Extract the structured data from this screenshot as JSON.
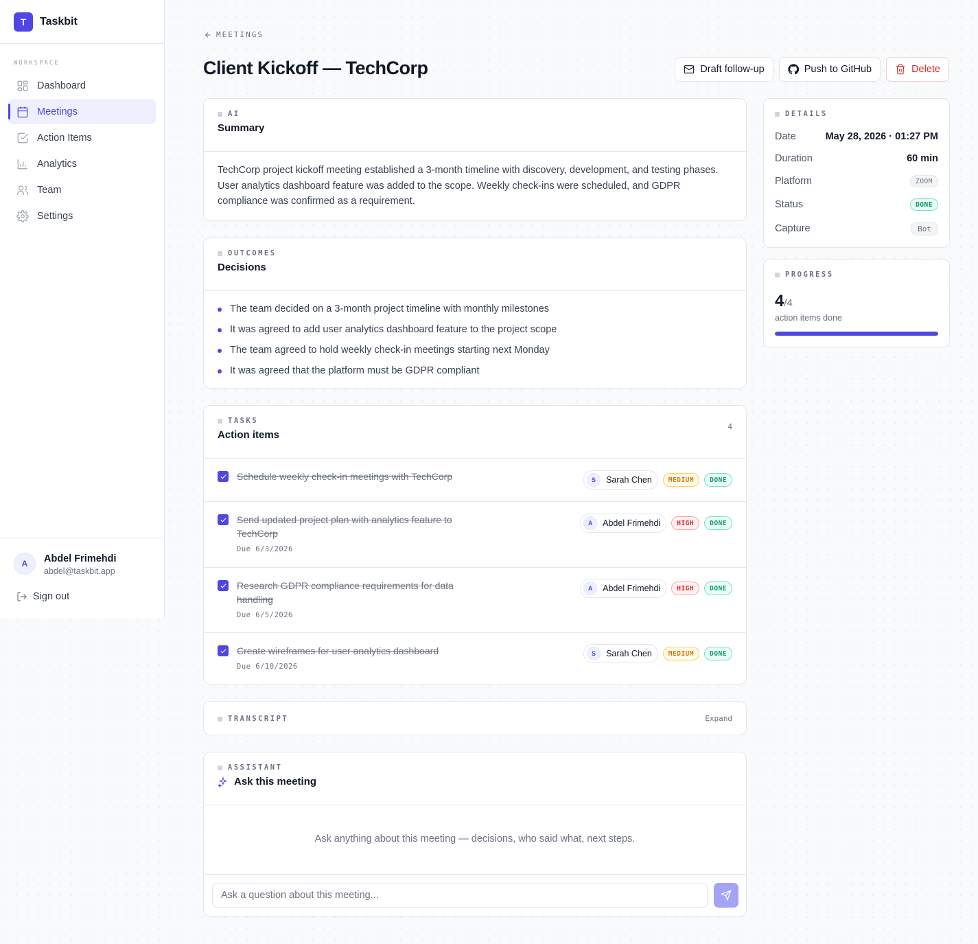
{
  "app": {
    "name": "Taskbit",
    "logo_letter": "T"
  },
  "sidebar": {
    "section_label": "WORKSPACE",
    "items": [
      {
        "label": "Dashboard",
        "icon": "dashboard-icon"
      },
      {
        "label": "Meetings",
        "icon": "calendar-icon",
        "active": true
      },
      {
        "label": "Action Items",
        "icon": "checkbox-icon"
      },
      {
        "label": "Analytics",
        "icon": "bar-chart-icon"
      },
      {
        "label": "Team",
        "icon": "users-icon"
      },
      {
        "label": "Settings",
        "icon": "gear-icon"
      }
    ],
    "user": {
      "initial": "A",
      "name": "Abdel Frimehdi",
      "email": "abdel@taskbit.app"
    },
    "sign_out": "Sign out"
  },
  "header": {
    "breadcrumb": "MEETINGS",
    "title": "Client Kickoff — TechCorp",
    "actions": {
      "draft": "Draft follow-up",
      "github": "Push to GitHub",
      "delete": "Delete"
    }
  },
  "summary": {
    "eyebrow": "AI",
    "title": "Summary",
    "text": "TechCorp project kickoff meeting established a 3-month timeline with discovery, development, and testing phases. User analytics dashboard feature was added to the scope. Weekly check-ins were scheduled, and GDPR compliance was confirmed as a requirement."
  },
  "decisions": {
    "eyebrow": "OUTCOMES",
    "title": "Decisions",
    "items": [
      "The team decided on a 3-month project timeline with monthly milestones",
      "It was agreed to add user analytics dashboard feature to the project scope",
      "The team agreed to hold weekly check-in meetings starting next Monday",
      "It was agreed that the platform must be GDPR compliant"
    ]
  },
  "tasks": {
    "eyebrow": "TASKS",
    "title": "Action items",
    "count": "4",
    "items": [
      {
        "text": "Schedule weekly check-in meetings with TechCorp",
        "due": "",
        "assignee_initial": "S",
        "assignee": "Sarah Chen",
        "priority": "MEDIUM",
        "status": "DONE"
      },
      {
        "text": "Send updated project plan with analytics feature to TechCorp",
        "due": "Due 6/3/2026",
        "assignee_initial": "A",
        "assignee": "Abdel Frimehdi",
        "priority": "HIGH",
        "status": "DONE"
      },
      {
        "text": "Research GDPR compliance requirements for data handling",
        "due": "Due 6/5/2026",
        "assignee_initial": "A",
        "assignee": "Abdel Frimehdi",
        "priority": "HIGH",
        "status": "DONE"
      },
      {
        "text": "Create wireframes for user analytics dashboard",
        "due": "Due 6/10/2026",
        "assignee_initial": "S",
        "assignee": "Sarah Chen",
        "priority": "MEDIUM",
        "status": "DONE"
      }
    ]
  },
  "transcript": {
    "eyebrow": "TRANSCRIPT",
    "expand": "Expand"
  },
  "assistant": {
    "eyebrow": "ASSISTANT",
    "title": "Ask this meeting",
    "empty": "Ask anything about this meeting — decisions, who said what, next steps.",
    "placeholder": "Ask a question about this meeting..."
  },
  "details": {
    "eyebrow": "DETAILS",
    "date_label": "Date",
    "date": "May 28, 2026 · 01:27 PM",
    "duration_label": "Duration",
    "duration": "60 min",
    "platform_label": "Platform",
    "platform": "ZOOM",
    "status_label": "Status",
    "status": "DONE",
    "capture_label": "Capture",
    "capture": "Bot"
  },
  "progress": {
    "eyebrow": "PROGRESS",
    "done": "4",
    "total": "/4",
    "caption": "action items done",
    "fraction": 1.0
  },
  "colors": {
    "accent": "#4f46e5",
    "danger": "#dc2626",
    "success": "#059669",
    "warning": "#d97706"
  }
}
